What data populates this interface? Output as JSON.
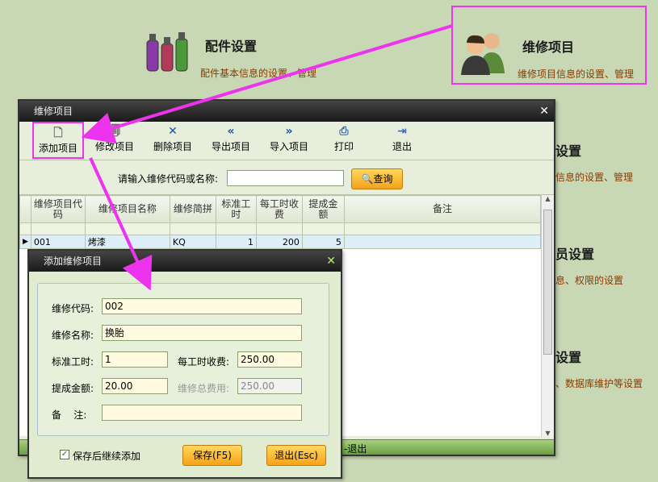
{
  "tiles": {
    "parts": {
      "title": "配件设置",
      "desc": "配件基本信息的设置、管理"
    },
    "repair": {
      "title": "维修项目",
      "desc": "维修项目信息的设置、管理"
    }
  },
  "side_items": [
    {
      "title": "设置",
      "desc": "信息的设置、管理"
    },
    {
      "title": "员设置",
      "desc": "息、权限的设置"
    },
    {
      "title": "设置",
      "desc": "、数据库维护等设置"
    }
  ],
  "main_window": {
    "title": "维修项目",
    "toolbar": [
      {
        "label": "添加项目",
        "icon": "new-document-icon"
      },
      {
        "label": "修改项目",
        "icon": "edit-document-icon"
      },
      {
        "label": "删除项目",
        "icon": "delete-x-icon"
      },
      {
        "label": "导出项目",
        "icon": "double-left-arrow-icon"
      },
      {
        "label": "导入项目",
        "icon": "double-right-arrow-icon"
      },
      {
        "label": "打印",
        "icon": "printer-icon"
      },
      {
        "label": "退出",
        "icon": "exit-door-icon"
      }
    ],
    "search_label": "请输入维修代码或名称:",
    "search_value": "",
    "search_button": "查询",
    "columns": [
      "维修项目代码",
      "维修项目名称",
      "维修简拼",
      "标准工时",
      "每工时收费",
      "提成金额",
      "备注"
    ],
    "rows": [
      [
        "001",
        "烤漆",
        "KQ",
        "1",
        "200",
        "5",
        ""
      ]
    ],
    "status_text": "-退出"
  },
  "dialog": {
    "title": "添加维修项目",
    "labels": {
      "code": "维修代码:",
      "name": "维修名称:",
      "std_hours": "标准工时:",
      "rate": "每工时收费:",
      "commission": "提成金额:",
      "total": "维修总费用:",
      "note": "备    注:"
    },
    "values": {
      "code": "002",
      "name": "换胎",
      "std_hours": "1",
      "rate": "250.00",
      "commission": "20.00",
      "total": "250.00",
      "note": ""
    },
    "continue_label": "保存后继续添加",
    "continue_checked": true,
    "save_button": "保存(F5)",
    "exit_button": "退出(Esc)"
  },
  "colors": {
    "annotation": "#ee33ee",
    "accent_orange": "#f5a31a",
    "background": "#c8d8b4"
  }
}
